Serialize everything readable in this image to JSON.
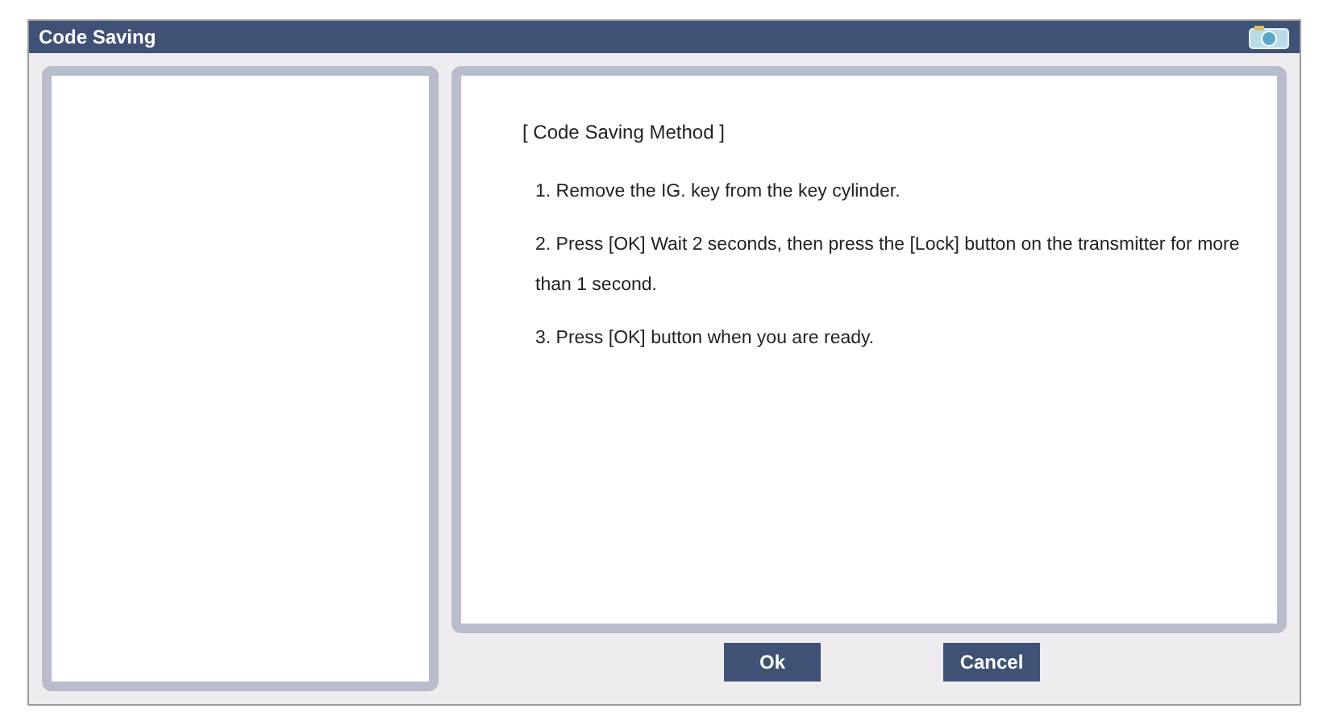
{
  "window": {
    "title": "Code Saving"
  },
  "content": {
    "heading": "[ Code Saving Method ]",
    "steps": [
      "1. Remove the IG. key from the key cylinder.",
      "2. Press [OK] Wait 2 seconds, then press the [Lock] button on the transmitter for more than 1 second.",
      "3. Press [OK] button when you are ready."
    ]
  },
  "buttons": [
    "Ok",
    "Cancel"
  ]
}
